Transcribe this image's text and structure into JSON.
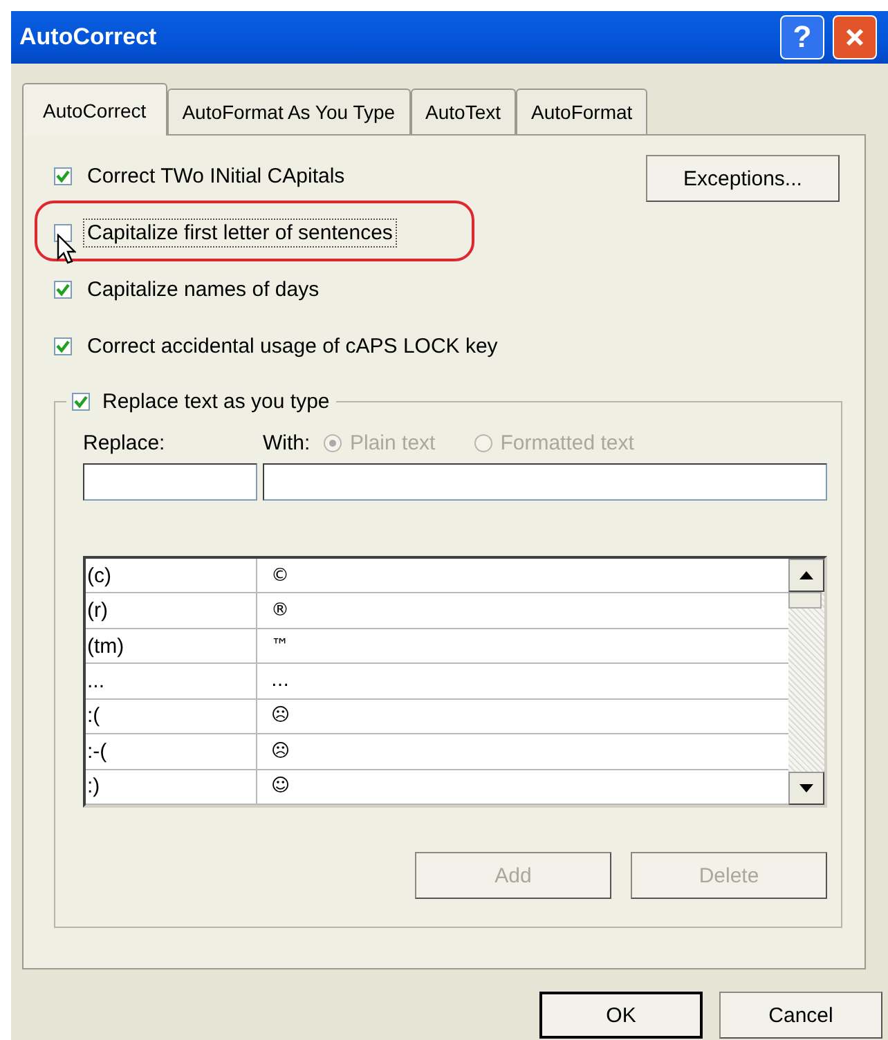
{
  "window": {
    "title": "AutoCorrect",
    "title_buttons": [
      {
        "kind": "help",
        "label": "?"
      },
      {
        "kind": "close"
      }
    ]
  },
  "tabs": [
    {
      "label": "AutoCorrect",
      "selected": true
    },
    {
      "label": "AutoFormat As You Type",
      "selected": false
    },
    {
      "label": "AutoText",
      "selected": false
    },
    {
      "label": "AutoFormat",
      "selected": false
    }
  ],
  "exceptions_button": "Exceptions...",
  "options": [
    {
      "label": "Correct TWo INitial CApitals",
      "checked": true,
      "highlighted": false,
      "hovered": false
    },
    {
      "label": "Capitalize first letter of sentences",
      "checked": false,
      "highlighted": true,
      "hovered": true
    },
    {
      "label": "Capitalize names of days",
      "checked": true,
      "highlighted": false,
      "hovered": false
    },
    {
      "label": "Correct accidental usage of cAPS LOCK key",
      "checked": true,
      "highlighted": false,
      "hovered": false
    }
  ],
  "replace_group": {
    "label": "Replace text as you type",
    "checked": true,
    "replace_label": "Replace:",
    "with_label": "With:",
    "format_disabled": true,
    "format_options": [
      {
        "label": "Plain text",
        "selected": true
      },
      {
        "label": "Formatted text",
        "selected": false
      }
    ],
    "entries": [
      {
        "replace": "(c)",
        "with": "©"
      },
      {
        "replace": "(r)",
        "with": "®"
      },
      {
        "replace": "(tm)",
        "with": "™"
      },
      {
        "replace": "...",
        "with": "…"
      },
      {
        "replace": ":(",
        "with": "☹"
      },
      {
        "replace": ":-(",
        "with": "☹"
      },
      {
        "replace": ":)",
        "with": "☺"
      }
    ],
    "buttons": [
      {
        "label": "Add",
        "disabled": true
      },
      {
        "label": "Delete",
        "disabled": true
      }
    ]
  },
  "dialog_buttons": [
    {
      "label": "OK",
      "default": true
    },
    {
      "label": "Cancel",
      "default": false
    }
  ]
}
